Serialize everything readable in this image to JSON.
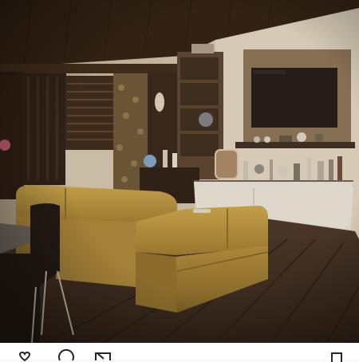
{
  "post": {
    "image": {
      "subject": "living-room-interior",
      "palette": {
        "ceiling": "#2e2014",
        "wall": "#d8cdb8",
        "sofa": "#b5923e",
        "floor": "#3b2a20",
        "tv_panel": "#8a7258",
        "cabinet": "#e6e1d6"
      }
    },
    "actions": {
      "like": "heart-icon",
      "comment": "comment-icon",
      "share": "send-icon",
      "save": "bookmark-icon"
    }
  }
}
